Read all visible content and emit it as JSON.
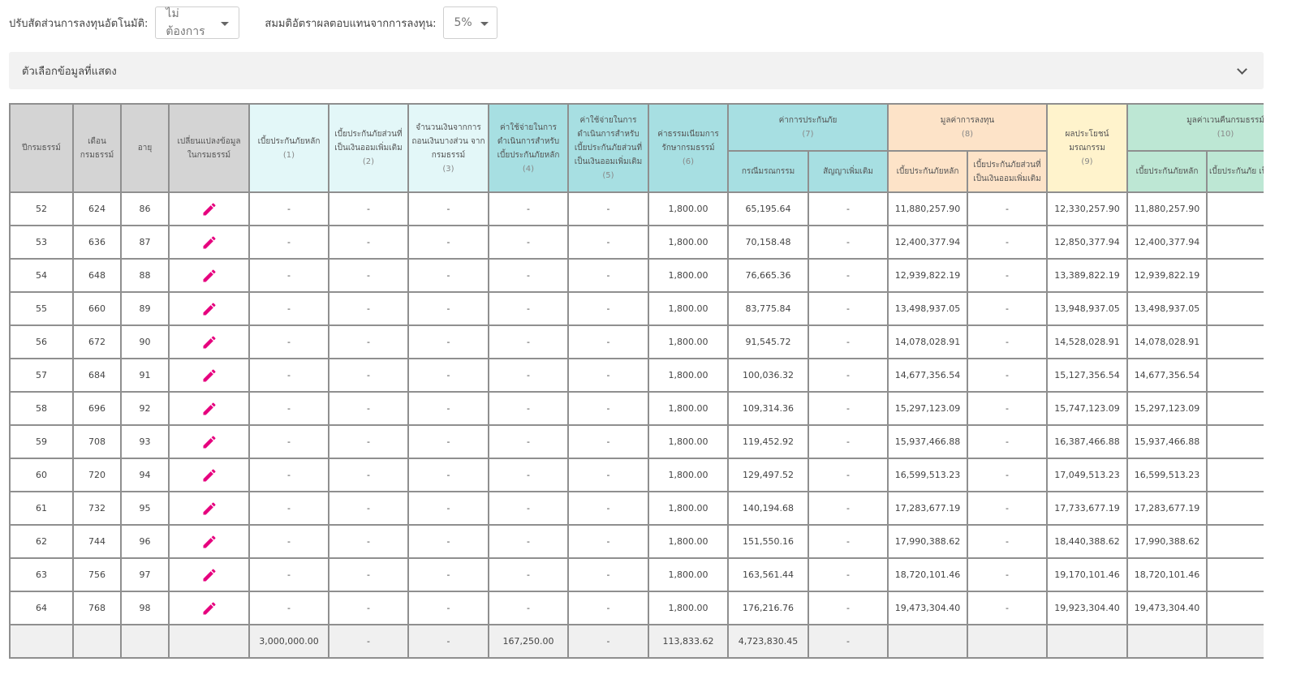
{
  "controls": {
    "auto_adjust_label": "ปรับสัดส่วนการลงทุนอัตโนมัติ:",
    "auto_adjust_value": "ไม่ต้องการ",
    "assumed_return_label": "สมมติอัตราผลตอบแทนจากการลงทุน:",
    "assumed_return_value": "5%"
  },
  "options_panel": {
    "title": "ตัวเลือกข้อมูลที่แสดง"
  },
  "colors": {
    "accent_pencil": "#e6007e"
  },
  "table": {
    "headers": {
      "policy_year": "ปีกรมธรรม์",
      "policy_month": "เดือน กรมธรรม์",
      "age": "อายุ",
      "change_data": "เปลี่ยนแปลงข้อมูล ในกรมธรรม์",
      "c1": "เบี้ยประกันภัยหลัก",
      "c1_num": "(1)",
      "c2": "เบี้ยประกันภัยส่วนที่ เป็นเงินออมเพิ่มเติม",
      "c2_num": "(2)",
      "c3": "จำนวนเงินจากการ ถอนเงินบางส่วน จากกรมธรรม์",
      "c3_num": "(3)",
      "c4": "ค่าใช้จ่ายในการ ดำเนินการสำหรับ เบี้ยประกันภัยหลัก",
      "c4_num": "(4)",
      "c5": "ค่าใช้จ่ายในการ ดำเนินการสำหรับ เบี้ยประกันภัยส่วนที่ เป็นเงินออมเพิ่มเติม",
      "c5_num": "(5)",
      "c6": "ค่าธรรมเนียมการ รักษากรมธรรม์",
      "c6_num": "(6)",
      "c7": "ค่าการประกันภัย",
      "c7_num": "(7)",
      "c7a": "กรณีมรณกรรม",
      "c7b": "สัญญาเพิ่มเติม",
      "c8": "มูลค่าการลงทุน",
      "c8_num": "(8)",
      "c8a": "เบี้ยประกันภัยหลัก",
      "c8b": "เบี้ยประกันภัยส่วนที่ เป็นเงินออมเพิ่มเติม",
      "c9": "ผลประโยชน์ มรณกรรม",
      "c9_num": "(9)",
      "c10": "มูลค่าเวนคืนกรมธรรม์",
      "c10_num": "(10)",
      "c10a": "เบี้ยประกันภัยหลัก",
      "c10b": "เบี้ยประกันภัย เป็นเงินออมเพิ่"
    },
    "rows": [
      [
        "52",
        "624",
        "86",
        "-",
        "-",
        "-",
        "-",
        "-",
        "1,800.00",
        "65,195.64",
        "-",
        "11,880,257.90",
        "-",
        "12,330,257.90",
        "11,880,257.90",
        "-"
      ],
      [
        "53",
        "636",
        "87",
        "-",
        "-",
        "-",
        "-",
        "-",
        "1,800.00",
        "70,158.48",
        "-",
        "12,400,377.94",
        "-",
        "12,850,377.94",
        "12,400,377.94",
        "-"
      ],
      [
        "54",
        "648",
        "88",
        "-",
        "-",
        "-",
        "-",
        "-",
        "1,800.00",
        "76,665.36",
        "-",
        "12,939,822.19",
        "-",
        "13,389,822.19",
        "12,939,822.19",
        "-"
      ],
      [
        "55",
        "660",
        "89",
        "-",
        "-",
        "-",
        "-",
        "-",
        "1,800.00",
        "83,775.84",
        "-",
        "13,498,937.05",
        "-",
        "13,948,937.05",
        "13,498,937.05",
        "-"
      ],
      [
        "56",
        "672",
        "90",
        "-",
        "-",
        "-",
        "-",
        "-",
        "1,800.00",
        "91,545.72",
        "-",
        "14,078,028.91",
        "-",
        "14,528,028.91",
        "14,078,028.91",
        "-"
      ],
      [
        "57",
        "684",
        "91",
        "-",
        "-",
        "-",
        "-",
        "-",
        "1,800.00",
        "100,036.32",
        "-",
        "14,677,356.54",
        "-",
        "15,127,356.54",
        "14,677,356.54",
        "-"
      ],
      [
        "58",
        "696",
        "92",
        "-",
        "-",
        "-",
        "-",
        "-",
        "1,800.00",
        "109,314.36",
        "-",
        "15,297,123.09",
        "-",
        "15,747,123.09",
        "15,297,123.09",
        "-"
      ],
      [
        "59",
        "708",
        "93",
        "-",
        "-",
        "-",
        "-",
        "-",
        "1,800.00",
        "119,452.92",
        "-",
        "15,937,466.88",
        "-",
        "16,387,466.88",
        "15,937,466.88",
        "-"
      ],
      [
        "60",
        "720",
        "94",
        "-",
        "-",
        "-",
        "-",
        "-",
        "1,800.00",
        "129,497.52",
        "-",
        "16,599,513.23",
        "-",
        "17,049,513.23",
        "16,599,513.23",
        "-"
      ],
      [
        "61",
        "732",
        "95",
        "-",
        "-",
        "-",
        "-",
        "-",
        "1,800.00",
        "140,194.68",
        "-",
        "17,283,677.19",
        "-",
        "17,733,677.19",
        "17,283,677.19",
        "-"
      ],
      [
        "62",
        "744",
        "96",
        "-",
        "-",
        "-",
        "-",
        "-",
        "1,800.00",
        "151,550.16",
        "-",
        "17,990,388.62",
        "-",
        "18,440,388.62",
        "17,990,388.62",
        "-"
      ],
      [
        "63",
        "756",
        "97",
        "-",
        "-",
        "-",
        "-",
        "-",
        "1,800.00",
        "163,561.44",
        "-",
        "18,720,101.46",
        "-",
        "19,170,101.46",
        "18,720,101.46",
        "-"
      ],
      [
        "64",
        "768",
        "98",
        "-",
        "-",
        "-",
        "-",
        "-",
        "1,800.00",
        "176,216.76",
        "-",
        "19,473,304.40",
        "-",
        "19,923,304.40",
        "19,473,304.40",
        "-"
      ]
    ],
    "totals": [
      "",
      "",
      "",
      "",
      "3,000,000.00",
      "-",
      "-",
      "167,250.00",
      "-",
      "113,833.62",
      "4,723,830.45",
      "-",
      "",
      "",
      "",
      "",
      ""
    ]
  }
}
